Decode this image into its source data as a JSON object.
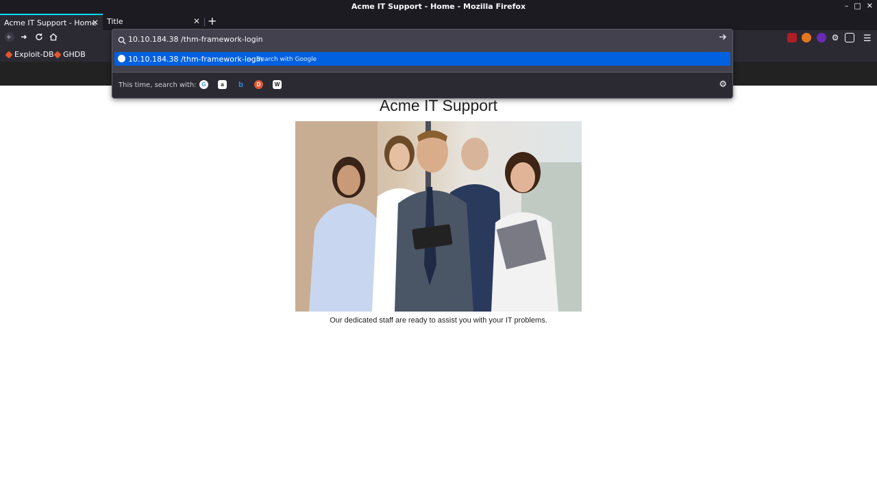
{
  "window": {
    "title": "Acme IT Support - Home - Mozilla Firefox",
    "controls": [
      "–",
      "□",
      "✕"
    ]
  },
  "tabs": [
    {
      "label": "Acme IT Support - Home",
      "active": true
    },
    {
      "label": "Title",
      "active": false
    }
  ],
  "toolbar": {
    "back_icon": "back-arrow-icon",
    "forward_icon": "forward-arrow-icon",
    "reload_icon": "reload-icon",
    "home_icon": "home-icon",
    "menu_icon": "hamburger-menu-icon",
    "new_tab_label": "+"
  },
  "bookmarks": [
    {
      "label": "Exploit-DB"
    },
    {
      "label": "GHDB"
    }
  ],
  "urlbar": {
    "value": "10.10.184.38 /thm-framework-login",
    "suggestion": {
      "text": "10.10.184.38 /thm-framework-login",
      "separator": "—",
      "action": "Search with Google"
    },
    "one_off_label": "This time, search with:",
    "engines": [
      "google",
      "amazon",
      "bing",
      "duckduckgo",
      "wikipedia"
    ]
  },
  "page": {
    "heading": "Acme IT Support",
    "caption": "Our dedicated staff are ready to assist you with your IT problems.",
    "header_color": "#222222"
  },
  "colors": {
    "accent": "#00ddff",
    "selection": "#0061e0",
    "chrome_dark": "#1c1b22",
    "chrome": "#2b2a33"
  }
}
